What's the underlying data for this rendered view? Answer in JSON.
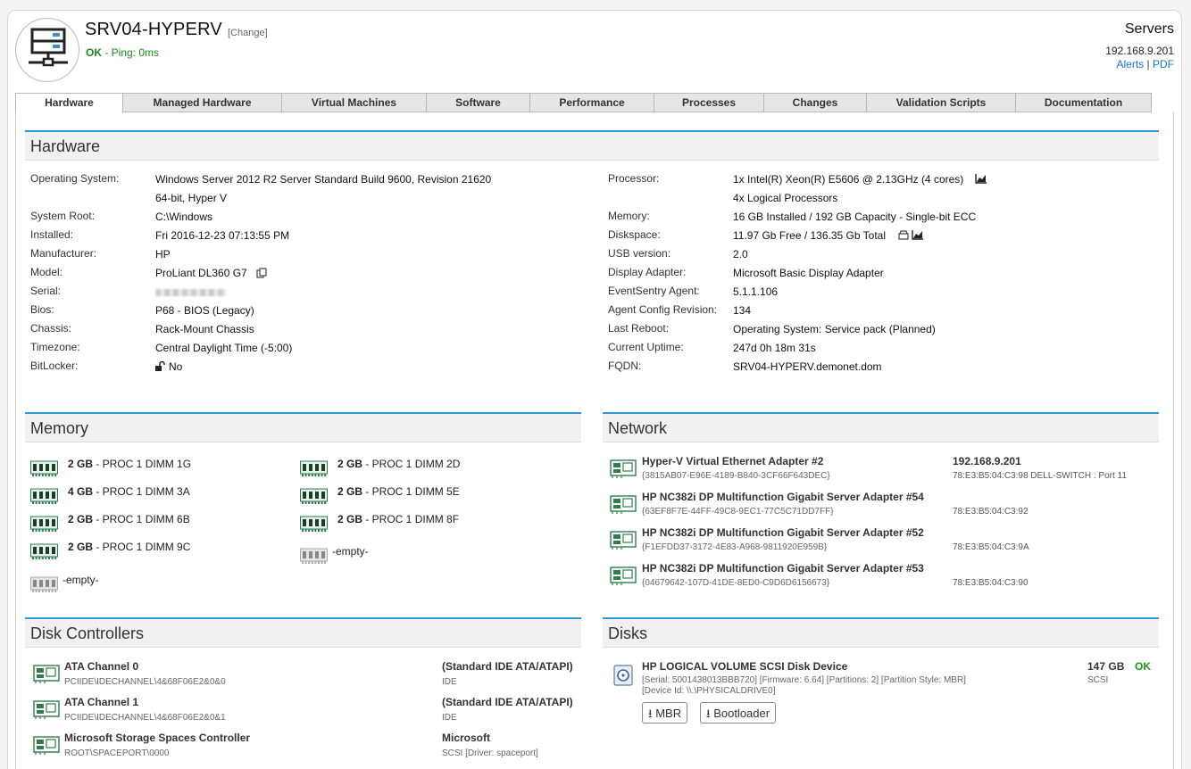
{
  "header": {
    "hostname": "SRV04-HYPERV",
    "change_label": "[Change]",
    "status_ok": "OK",
    "status_rest": " - Ping: 0ms",
    "group": "Servers",
    "ip": "192.168.9.201",
    "link_alerts": "Alerts",
    "link_sep": "|",
    "link_pdf": "PDF"
  },
  "tabs": [
    "Hardware",
    "Managed Hardware",
    "Virtual Machines",
    "Software",
    "Performance",
    "Processes",
    "Changes",
    "Validation Scripts",
    "Documentation"
  ],
  "hardware": {
    "title": "Hardware",
    "left": [
      {
        "k": "Operating System:",
        "v": "Windows Server 2012 R2 Server Standard Build 9600, Revision 21620",
        "v2": "64-bit, Hyper V"
      },
      {
        "k": "System Root:",
        "v": "C:\\Windows"
      },
      {
        "k": "Installed:",
        "v": "Fri 2016-12-23 07:13:55 PM"
      },
      {
        "k": "Manufacturer:",
        "v": "HP"
      },
      {
        "k": "Model:",
        "v": "ProLiant DL360 G7"
      },
      {
        "k": "Serial:",
        "v": ""
      },
      {
        "k": "Bios:",
        "v": "P68 - BIOS (Legacy)"
      },
      {
        "k": "Chassis:",
        "v": "Rack-Mount Chassis"
      },
      {
        "k": "Timezone:",
        "v": "Central Daylight Time (-5:00)"
      },
      {
        "k": "BitLocker:",
        "v": "No"
      }
    ],
    "right": [
      {
        "k": "Processor:",
        "v": "1x Intel(R) Xeon(R) E5606 @ 2.13GHz (4 cores)",
        "v2": "4x Logical Processors"
      },
      {
        "k": "Memory:",
        "v": "16 GB Installed / 192 GB Capacity - Single-bit ECC"
      },
      {
        "k": "Diskspace:",
        "v": "11.97 Gb Free / 136.35 Gb Total"
      },
      {
        "k": "USB version:",
        "v": "2.0"
      },
      {
        "k": "Display Adapter:",
        "v": "Microsoft Basic Display Adapter"
      },
      {
        "k": "EventSentry Agent:",
        "v": "5.1.1.106"
      },
      {
        "k": "Agent Config Revision:",
        "v": "134"
      },
      {
        "k": "Last Reboot:",
        "v": "Operating System: Service pack (Planned)"
      },
      {
        "k": "Current Uptime:",
        "v": "247d 0h 18m 31s"
      },
      {
        "k": "FQDN:",
        "v": "SRV04-HYPERV.demonet.dom"
      }
    ]
  },
  "memory": {
    "title": "Memory",
    "slots": [
      {
        "size": "2 GB",
        "label": " - PROC 1 DIMM 1G"
      },
      {
        "size": "2 GB",
        "label": " - PROC 1 DIMM 2D"
      },
      {
        "size": "4 GB",
        "label": " - PROC 1 DIMM 3A"
      },
      {
        "size": "2 GB",
        "label": " - PROC 1 DIMM 5E"
      },
      {
        "size": "2 GB",
        "label": " - PROC 1 DIMM 6B"
      },
      {
        "size": "2 GB",
        "label": " - PROC 1 DIMM 8F"
      },
      {
        "size": "2 GB",
        "label": " - PROC 1 DIMM 9C"
      },
      {
        "size": "",
        "label": "-empty-"
      },
      {
        "size": "",
        "label": "-empty-"
      }
    ]
  },
  "network": {
    "title": "Network",
    "adapters": [
      {
        "name": "Hyper-V Virtual Ethernet Adapter #2",
        "guid": "{3815AB07-E96E-4189-B840-3CF66F643DEC}",
        "ip": "192.168.9.201",
        "mac": "78:E3:B5:04:C3:98  DELL-SWITCH : Port 11"
      },
      {
        "name": "HP NC382i DP Multifunction Gigabit Server Adapter #54",
        "guid": "{63EF8F7E-44FF-49C8-9EC1-77C5C71DD7FF}",
        "ip": "",
        "mac": "78:E3:B5:04:C3:92"
      },
      {
        "name": "HP NC382i DP Multifunction Gigabit Server Adapter #52",
        "guid": "{F1EFDD37-3172-4E83-A968-9811920E959B}",
        "ip": "",
        "mac": "78:E3:B5:04:C3:9A"
      },
      {
        "name": "HP NC382i DP Multifunction Gigabit Server Adapter #53",
        "guid": "{04679642-107D-41DE-8ED0-C9D6D6156673}",
        "ip": "",
        "mac": "78:E3:B5:04:C3:90"
      }
    ]
  },
  "controllers": {
    "title": "Disk Controllers",
    "items": [
      {
        "name": "ATA Channel 0",
        "path": "PCIIDE\\IDECHANNEL\\4&68F06E2&0&0",
        "vendor": "(Standard IDE ATA/ATAPI)",
        "type": "IDE"
      },
      {
        "name": "ATA Channel 1",
        "path": "PCIIDE\\IDECHANNEL\\4&68F06E2&0&1",
        "vendor": "(Standard IDE ATA/ATAPI)",
        "type": "IDE"
      },
      {
        "name": "Microsoft Storage Spaces Controller",
        "path": "ROOT\\SPACEPORT\\0000",
        "vendor": "Microsoft",
        "type": "SCSI [Driver: spaceport]"
      }
    ]
  },
  "disks": {
    "title": "Disks",
    "name": "HP LOGICAL VOLUME SCSI Disk Device",
    "detail1": "[Serial: 5001438013BBB720] [Firmware: 6.64] [Partitions: 2] [Partition Style: MBR]",
    "detail2": "[Device Id: \\\\.\\PHYSICALDRIVE0]",
    "size": "147 GB",
    "status": "OK",
    "bus": "SCSI",
    "btn_mbr": "MBR",
    "btn_boot": "Bootloader"
  },
  "colors": {
    "accent": "#2a9ad8",
    "ok": "#1a9a1a",
    "link": "#1a73c8",
    "ram": "#2e7d4f"
  }
}
